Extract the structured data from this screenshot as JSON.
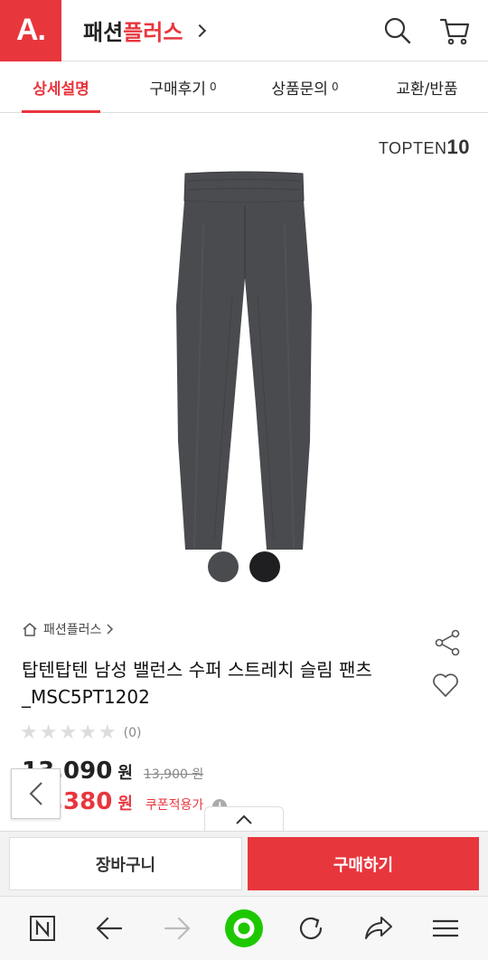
{
  "header": {
    "logo": "A.",
    "brand_part1": "패션",
    "brand_part2": "플러스"
  },
  "tabs": [
    {
      "label": "상세설명",
      "count": ""
    },
    {
      "label": "구매후기",
      "count": "0"
    },
    {
      "label": "상품문의",
      "count": "0"
    },
    {
      "label": "교환/반품",
      "count": ""
    }
  ],
  "product": {
    "brand_logo_text": "TOPTEN",
    "brand_logo_num": "10",
    "swatch_colors": [
      "#4a4b4e",
      "#1f1f21"
    ],
    "breadcrumb": "패션플러스",
    "title": "탑텐탑텐 남성 밸런스 수퍼 스트레치 슬림 팬츠_MSC5PT1202",
    "rating_count": "(0)",
    "price": "13,090",
    "price_unit": "원",
    "original_price": "13,900 원",
    "coupon_price": "12,380",
    "coupon_unit": "원",
    "coupon_label": "쿠폰적용가",
    "info_glyph": "i"
  },
  "buttons": {
    "cart": "장바구니",
    "buy": "구매하기"
  },
  "colors": {
    "accent": "#e8363d"
  }
}
